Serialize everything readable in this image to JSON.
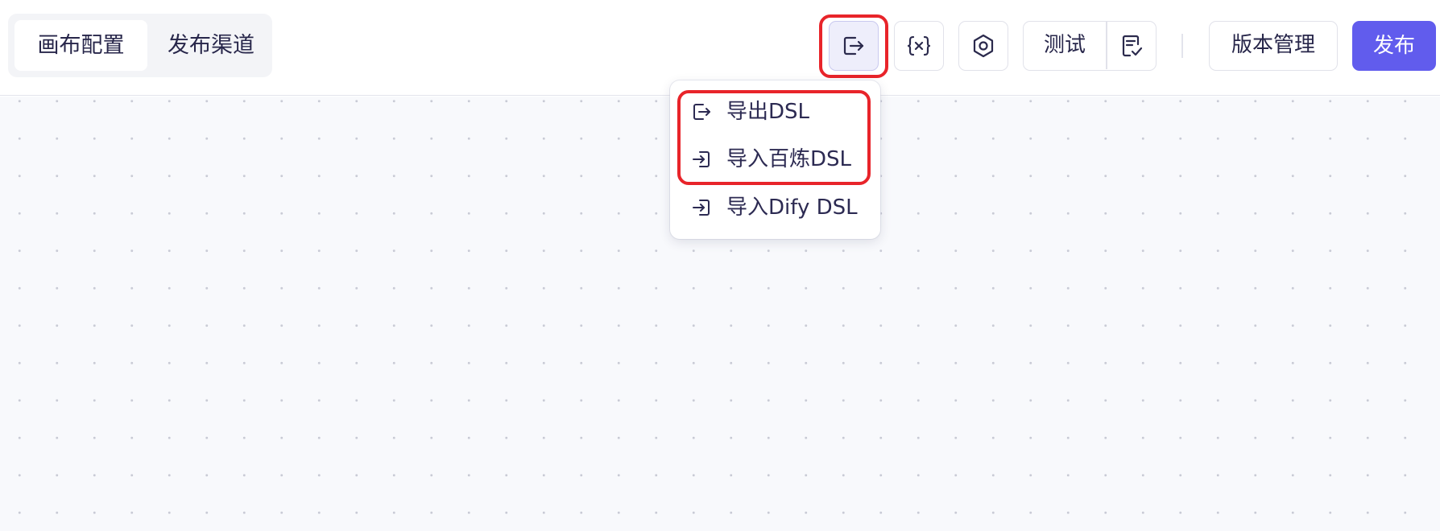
{
  "tabs": [
    {
      "label": "画布配置",
      "active": true
    },
    {
      "label": "发布渠道",
      "active": false
    }
  ],
  "toolbar": {
    "export_icon": "export-dsl-icon",
    "variable_icon": "variable-x-icon",
    "settings_icon": "gear-icon",
    "test_label": "测试",
    "run_log_icon": "checklist-icon",
    "version_label": "版本管理",
    "publish_label": "发布",
    "accent_color": "#615ced"
  },
  "menu": {
    "items": [
      {
        "label": "导出DSL",
        "icon": "export-icon"
      },
      {
        "label": "导入百炼DSL",
        "icon": "import-icon"
      },
      {
        "label": "导入Dify DSL",
        "icon": "import-icon"
      }
    ]
  },
  "annotations": {
    "highlight_color": "#e8242a"
  }
}
